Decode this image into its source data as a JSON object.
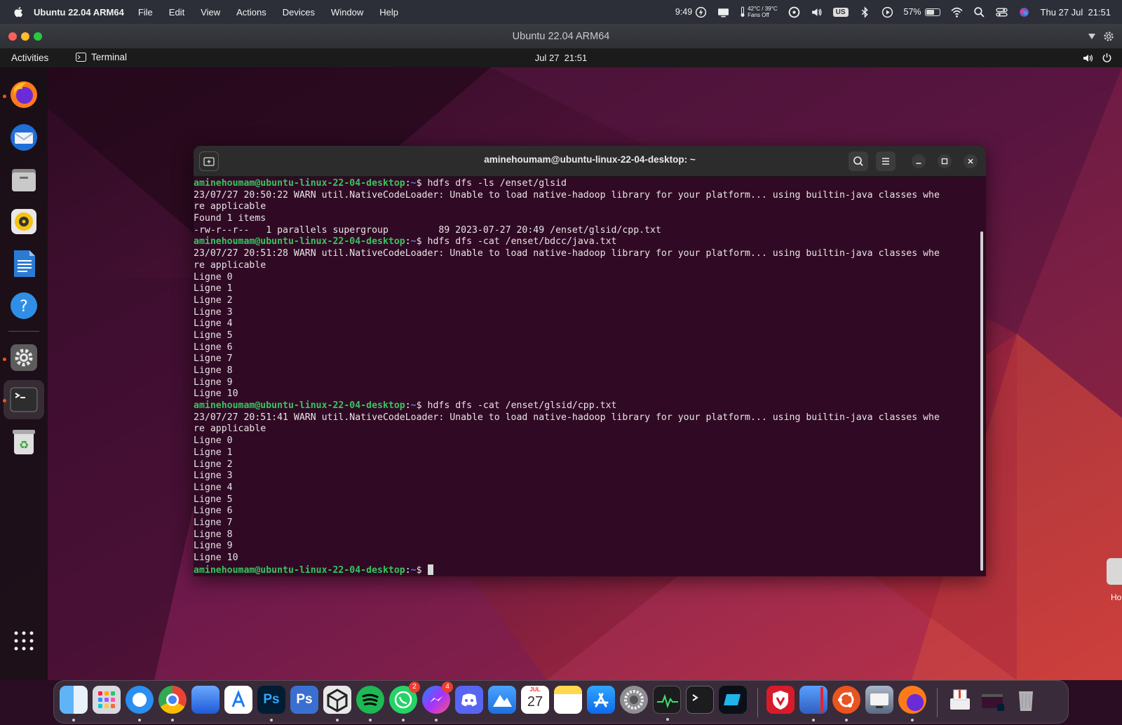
{
  "mac_menubar": {
    "app_name": "Ubuntu 22.04 ARM64",
    "menus": [
      "File",
      "Edit",
      "View",
      "Actions",
      "Devices",
      "Window",
      "Help"
    ],
    "status": {
      "time_remaining": "9:49",
      "temperature": "42°C / 39°C",
      "fans": "Fans Off",
      "input_source": "US",
      "battery": "57%",
      "datetime": "Thu 27 Jul  21:51"
    }
  },
  "vm_window": {
    "title": "Ubuntu 22.04 ARM64"
  },
  "ubuntu_topbar": {
    "activities": "Activities",
    "app": "Terminal",
    "clock": "Jul 27  21:51"
  },
  "ubuntu_dock": {
    "items": [
      "firefox-icon",
      "thunderbird-icon",
      "files-icon",
      "rhythmbox-icon",
      "writer-icon",
      "help-icon",
      "settings-icon",
      "terminal-icon",
      "trash-icon"
    ],
    "show_apps": "apps-grid-icon"
  },
  "terminal": {
    "title": "aminehoumam@ubuntu-linux-22-04-desktop: ~",
    "prompt_user": "aminehoumam@ubuntu-linux-22-04-desktop",
    "prompt_path": "~",
    "prompt_symbol": "$",
    "command_1": " hdfs dfs -ls /enset/glsid",
    "warn_1a": "23/07/27 20:50:22 WARN util.NativeCodeLoader: Unable to load native-hadoop library for your platform... using builtin-java classes whe",
    "warn_1b": "re applicable",
    "found": "Found 1 items",
    "listing": "-rw-r--r--   1 parallels supergroup         89 2023-07-27 20:49 /enset/glsid/cpp.txt",
    "command_2": " hdfs dfs -cat /enset/bdcc/java.txt",
    "warn_2a": "23/07/27 20:51:28 WARN util.NativeCodeLoader: Unable to load native-hadoop library for your platform... using builtin-java classes whe",
    "warn_2b": "re applicable",
    "output_2": [
      "Ligne 0",
      "Ligne 1",
      "Ligne 2",
      "Ligne 3",
      "Ligne 4",
      "Ligne 5",
      "Ligne 6",
      "Ligne 7",
      "Ligne 8",
      "Ligne 9",
      "Ligne 10"
    ],
    "command_3": " hdfs dfs -cat /enset/glsid/cpp.txt",
    "warn_3a": "23/07/27 20:51:41 WARN util.NativeCodeLoader: Unable to load native-hadoop library for your platform... using builtin-java classes whe",
    "warn_3b": "re applicable",
    "output_3": [
      "Ligne 0",
      "Ligne 1",
      "Ligne 2",
      "Ligne 3",
      "Ligne 4",
      "Ligne 5",
      "Ligne 6",
      "Ligne 7",
      "Ligne 8",
      "Ligne 9",
      "Ligne 10"
    ]
  },
  "mac_dock": {
    "whatsapp_badge": "2",
    "messenger_badge": "4",
    "calendar_month": "JUL",
    "calendar_day": "27",
    "ps_label": "Ps"
  },
  "colors": {
    "terminal_bg": "#300a24",
    "prompt_green": "#37c55e",
    "path_blue": "#5d7fd6",
    "ubuntu_orange": "#e95420"
  }
}
